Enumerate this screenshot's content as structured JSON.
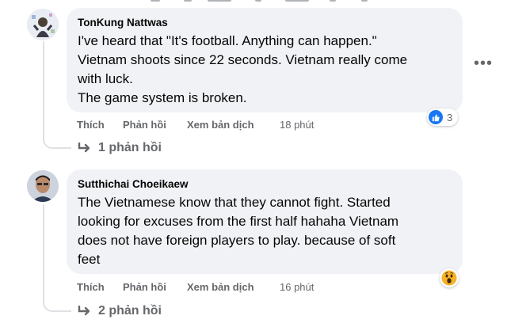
{
  "colors": {
    "bubble_bg": "#f0f2f5",
    "action_text": "#65676b",
    "like_blue": "#1877f2",
    "thread_line": "#dfe1e5"
  },
  "comments": [
    {
      "author": "TonKung Nattwas",
      "text": "I've heard that \"It's football. Anything can happen.\"\nVietnam shoots since 22 seconds. Vietnam really come\nwith luck.\nThe game system is broken.",
      "actions": {
        "like": "Thích",
        "reply": "Phản hồi",
        "translate": "Xem bản dịch",
        "time": "18 phút"
      },
      "reaction": {
        "icon": "like-icon",
        "count": "3"
      },
      "replies_label": "1 phản hồi",
      "more_icon": "more-options-icon"
    },
    {
      "author": "Sutthichai Choeikaew",
      "text": "The Vietnamese know that they cannot fight. Started\nlooking for excuses from the first half hahaha Vietnam\ndoes not have foreign players to play. because of soft\nfeet",
      "actions": {
        "like": "Thích",
        "reply": "Phản hồi",
        "translate": "Xem bản dịch",
        "time": "16 phút"
      },
      "reaction": {
        "icon": "wow-icon"
      },
      "replies_label": "2 phản hồi"
    }
  ]
}
